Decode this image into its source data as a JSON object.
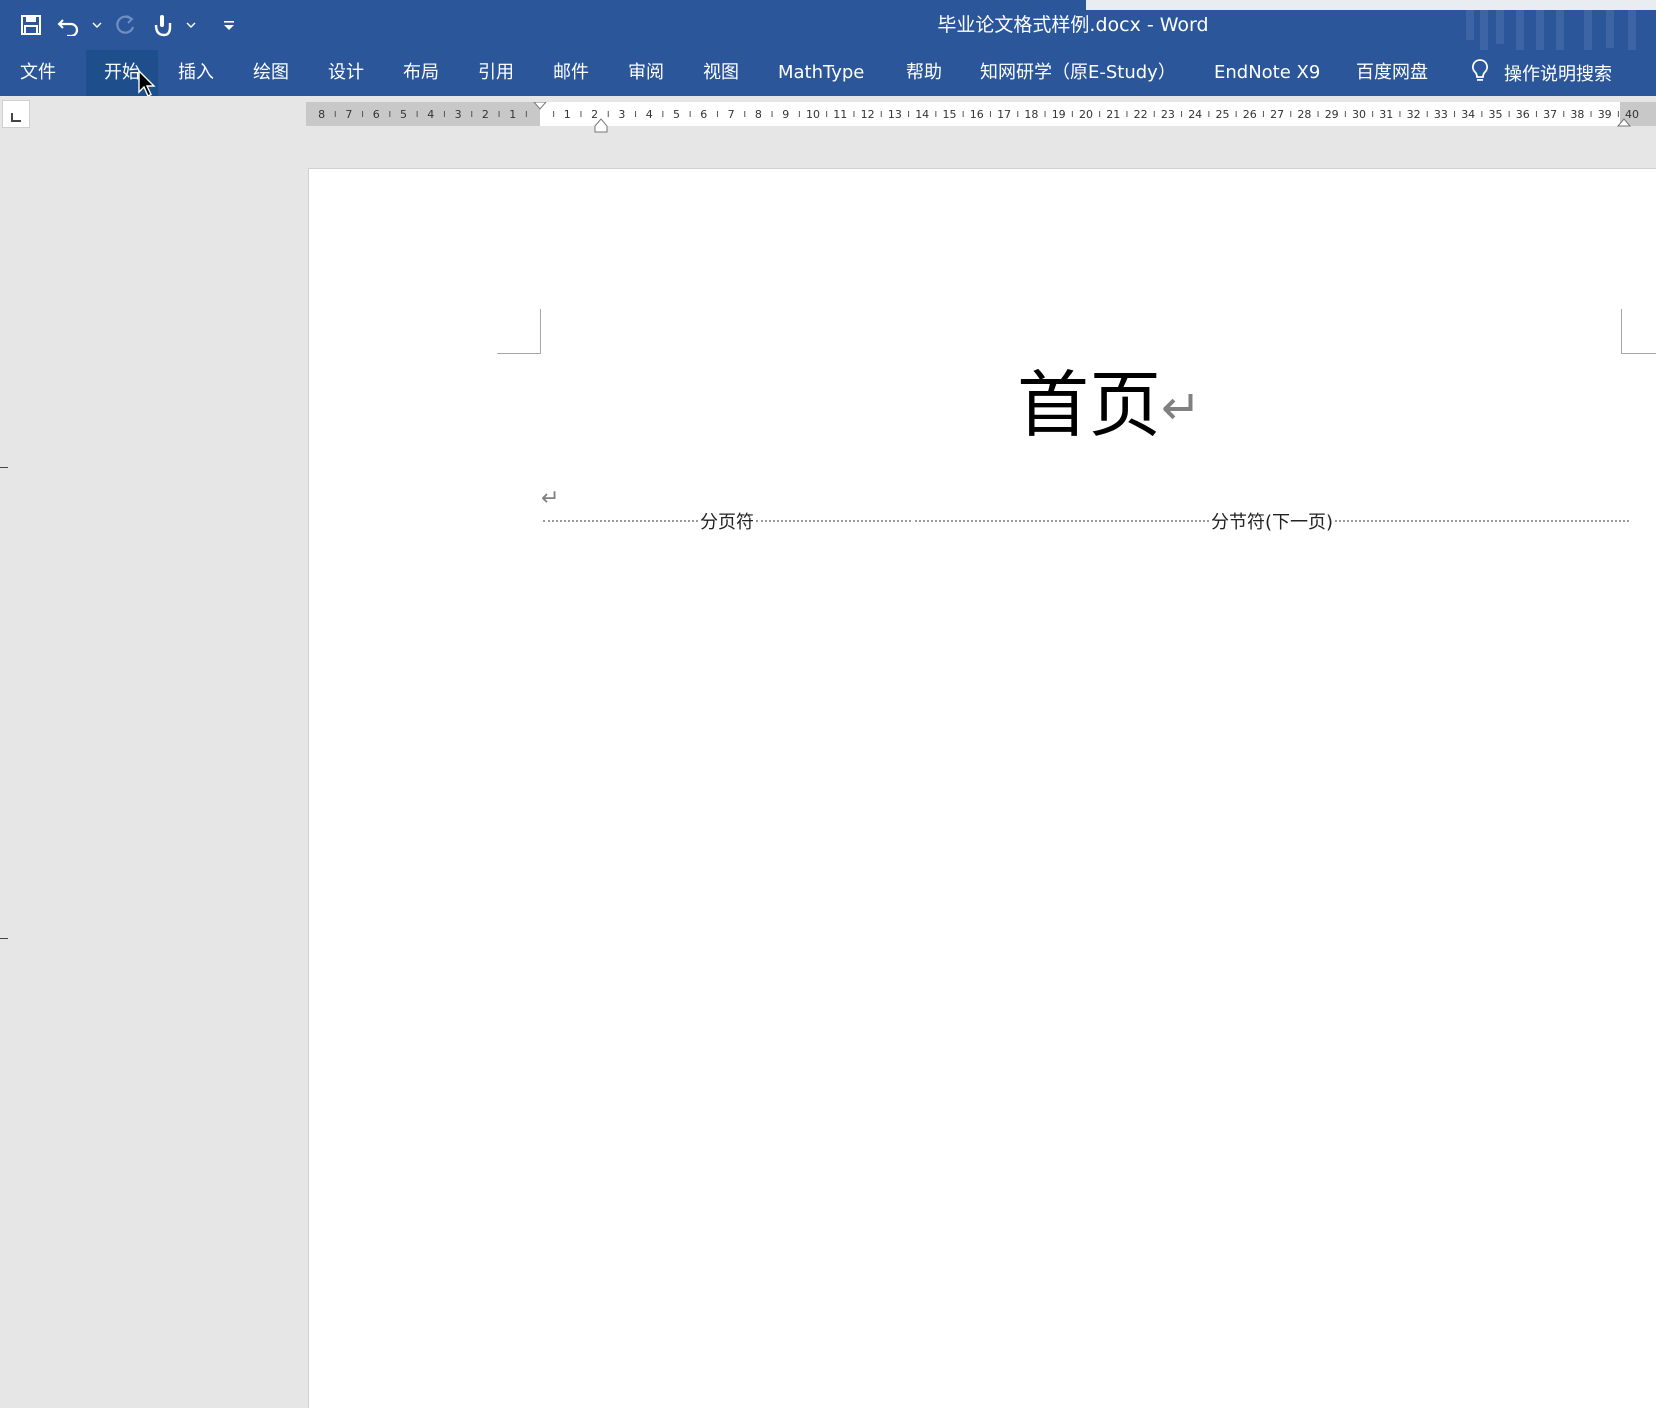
{
  "titlebar": {
    "title": "毕业论文格式样例.docx  -  Word",
    "qat": [
      {
        "name": "save-icon"
      },
      {
        "name": "undo-icon"
      },
      {
        "name": "redo-icon"
      },
      {
        "name": "touch-mode-icon"
      },
      {
        "name": "customize-qat-icon"
      }
    ]
  },
  "tabs": [
    {
      "label": "文件",
      "key": "file"
    },
    {
      "label": "开始",
      "key": "home",
      "active": true
    },
    {
      "label": "插入",
      "key": "insert"
    },
    {
      "label": "绘图",
      "key": "draw"
    },
    {
      "label": "设计",
      "key": "design"
    },
    {
      "label": "布局",
      "key": "layout"
    },
    {
      "label": "引用",
      "key": "references"
    },
    {
      "label": "邮件",
      "key": "mailings"
    },
    {
      "label": "审阅",
      "key": "review"
    },
    {
      "label": "视图",
      "key": "view"
    },
    {
      "label": "MathType",
      "key": "mathtype"
    },
    {
      "label": "帮助",
      "key": "help"
    },
    {
      "label": "知网研学（原E-Study）",
      "key": "estudy"
    },
    {
      "label": "EndNote X9",
      "key": "endnote"
    },
    {
      "label": "百度网盘",
      "key": "baidu"
    }
  ],
  "tellme": {
    "label": "操作说明搜索",
    "icon": "lightbulb-icon"
  },
  "ruler": {
    "left_numbers": [
      "8",
      "7",
      "6",
      "5",
      "4",
      "3",
      "2",
      "1"
    ],
    "right_numbers": [
      "1",
      "2",
      "3",
      "4",
      "5",
      "6",
      "7",
      "8",
      "9",
      "10",
      "11",
      "12",
      "13",
      "14",
      "15",
      "16",
      "17",
      "18",
      "19",
      "20",
      "21",
      "22",
      "23",
      "24",
      "25",
      "26",
      "27",
      "28",
      "29",
      "30",
      "31",
      "32",
      "33",
      "34",
      "35",
      "36",
      "37",
      "38",
      "39",
      "40"
    ]
  },
  "document": {
    "heading": "首页",
    "paragraph_mark": "↵",
    "page_break_label": "分页符",
    "section_break_label": "分节符(下一页)"
  },
  "colors": {
    "ribbon": "#2b579a",
    "active_tab": "#1e4e8c",
    "workspace": "#e6e6e6"
  }
}
